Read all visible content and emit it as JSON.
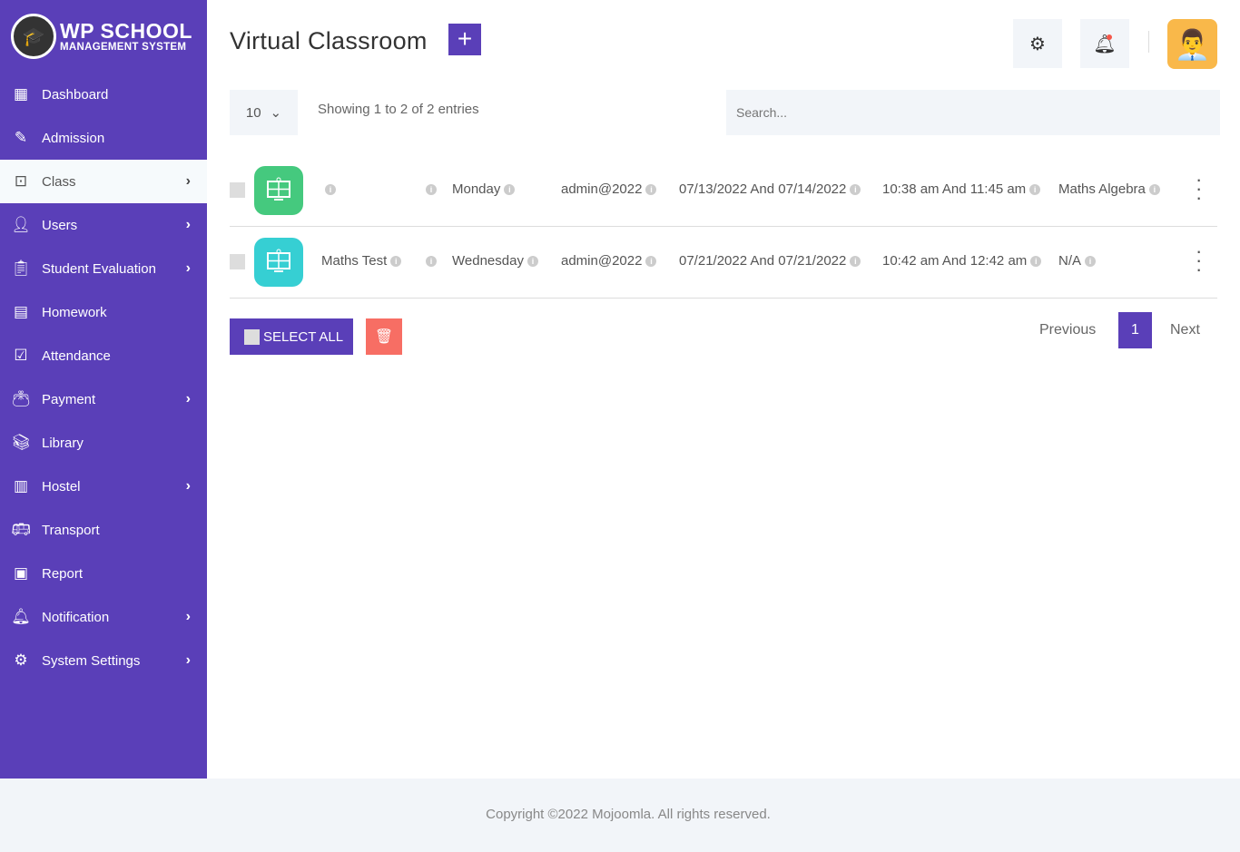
{
  "brand": {
    "title": "WP SCHOOL",
    "subtitle": "MANAGEMENT SYSTEM"
  },
  "sidebar": {
    "items": [
      {
        "label": "Dashboard",
        "icon": "grid-icon",
        "chevron": false
      },
      {
        "label": "Admission",
        "icon": "form-icon",
        "chevron": false
      },
      {
        "label": "Class",
        "icon": "teacher-board-icon",
        "chevron": true,
        "active": true
      },
      {
        "label": "Users",
        "icon": "user-icon",
        "chevron": true
      },
      {
        "label": "Student Evaluation",
        "icon": "clipboard-icon",
        "chevron": true
      },
      {
        "label": "Homework",
        "icon": "homework-icon",
        "chevron": false
      },
      {
        "label": "Attendance",
        "icon": "check-clipboard-icon",
        "chevron": false
      },
      {
        "label": "Payment",
        "icon": "wallet-icon",
        "chevron": true
      },
      {
        "label": "Library",
        "icon": "books-icon",
        "chevron": false
      },
      {
        "label": "Hostel",
        "icon": "hostel-icon",
        "chevron": true
      },
      {
        "label": "Transport",
        "icon": "bus-icon",
        "chevron": false
      },
      {
        "label": "Report",
        "icon": "report-icon",
        "chevron": false
      },
      {
        "label": "Notification",
        "icon": "bell-icon",
        "chevron": true
      },
      {
        "label": "System Settings",
        "icon": "gear-icon",
        "chevron": true
      }
    ]
  },
  "header": {
    "title": "Virtual Classroom",
    "add": "+"
  },
  "table": {
    "page_length": "10",
    "info": "Showing 1 to 2 of 2 entries",
    "search_placeholder": "Search...",
    "rows": [
      {
        "name": "",
        "col2": "",
        "day": "Monday",
        "created_by": "admin@2022",
        "dates": "07/13/2022 And 07/14/2022",
        "times": "10:38 am And 11:45 am",
        "subject": "Maths Algebra",
        "icon_color": "#45c97e"
      },
      {
        "name": "Maths Test",
        "col2": "",
        "day": "Wednesday",
        "created_by": "admin@2022",
        "dates": "07/21/2022 And 07/21/2022",
        "times": "10:42 am And 12:42 am",
        "subject": "N/A",
        "icon_color": "#36cfd3"
      }
    ]
  },
  "actions": {
    "select_all": "SELECT ALL"
  },
  "pagination": {
    "previous": "Previous",
    "current": "1",
    "next": "Next"
  },
  "footer": {
    "text": "Copyright ©2022 Mojoomla. All rights reserved."
  },
  "colors": {
    "accent": "#5a3fb8",
    "delete": "#f76e64"
  }
}
